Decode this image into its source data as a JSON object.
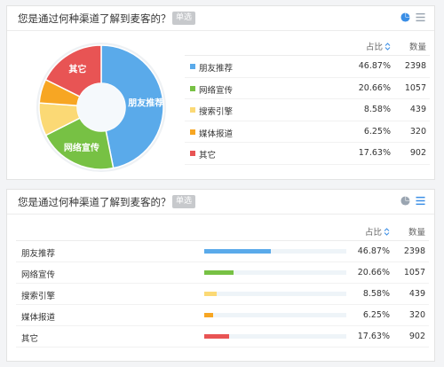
{
  "question": {
    "title": "您是通过何种渠道了解到麦客的？",
    "type_badge": "单选"
  },
  "table_header": {
    "percent": "占比",
    "count": "数量"
  },
  "colors": {
    "blue": "#5aaaea",
    "green": "#77c144",
    "yellow": "#fbd975",
    "orange": "#f7a623",
    "red": "#e85454",
    "icon_gray": "#9aa5b1",
    "icon_active": "#3a8ee6"
  },
  "icons": [
    "pie-chart-icon",
    "list-icon",
    "sort-icon"
  ],
  "chart_data": [
    {
      "type": "pie",
      "style": "donut",
      "categories": [
        "朋友推荐",
        "网络宣传",
        "搜索引擎",
        "媒体报道",
        "其它"
      ],
      "values": [
        46.87,
        20.66,
        8.58,
        6.25,
        17.63
      ],
      "percent_labels": [
        "46.87%",
        "20.66%",
        "8.58%",
        "6.25%",
        "17.63%"
      ],
      "counts": [
        "2398",
        "1057",
        "439",
        "320",
        "902"
      ],
      "colors": [
        "#5aaaea",
        "#77c144",
        "#fbd975",
        "#f7a623",
        "#e85454"
      ],
      "slice_labels": [
        "朋友推荐",
        "网络宣传",
        "",
        "",
        "其它"
      ],
      "legend": "right"
    },
    {
      "type": "bar",
      "orientation": "horizontal",
      "categories": [
        "朋友推荐",
        "网络宣传",
        "搜索引擎",
        "媒体报道",
        "其它"
      ],
      "values": [
        46.87,
        20.66,
        8.58,
        6.25,
        17.63
      ],
      "percent_labels": [
        "46.87%",
        "20.66%",
        "8.58%",
        "6.25%",
        "17.63%"
      ],
      "counts": [
        "2398",
        "1057",
        "439",
        "320",
        "902"
      ],
      "colors": [
        "#5aaaea",
        "#77c144",
        "#fbd975",
        "#f7a623",
        "#e85454"
      ],
      "xlim": [
        0,
        100
      ]
    }
  ]
}
